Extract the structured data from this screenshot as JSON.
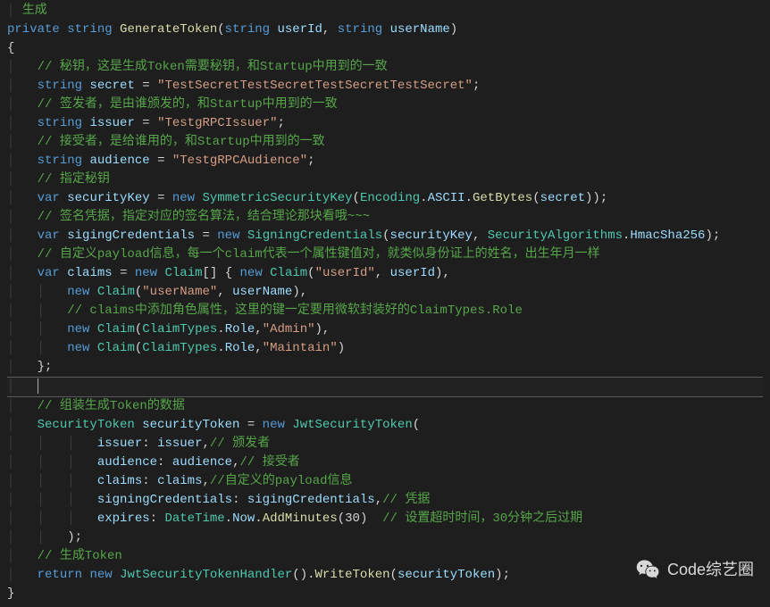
{
  "code": {
    "line0_partial": "生成",
    "sig_private": "private",
    "sig_string": "string",
    "sig_method": "GenerateToken",
    "sig_param1_type": "string",
    "sig_param1_name": "userId",
    "sig_param2_type": "string",
    "sig_param2_name": "userName",
    "comment1": "// 秘钥，这是生成Token需要秘钥，和Startup中用到的一致",
    "l3_type": "string",
    "l3_var": "secret",
    "l3_val": "\"TestSecretTestSecretTestSecretTestSecret\"",
    "comment2": "// 签发者，是由谁颁发的，和Startup中用到的一致",
    "l5_type": "string",
    "l5_var": "issuer",
    "l5_val": "\"TestgRPCIssuer\"",
    "comment3": "// 接受者，是给谁用的，和Startup中用到的一致",
    "l7_type": "string",
    "l7_var": "audience",
    "l7_val": "\"TestgRPCAudience\"",
    "comment4": "// 指定秘钥",
    "l9_var_kw": "var",
    "l9_var": "securityKey",
    "l9_new": "new",
    "l9_type": "SymmetricSecurityKey",
    "l9_enc": "Encoding",
    "l9_ascii": "ASCII",
    "l9_getbytes": "GetBytes",
    "l9_secret": "secret",
    "comment5": "// 签名凭据，指定对应的签名算法，结合理论那块看哦~~~",
    "l11_var_kw": "var",
    "l11_var": "sigingCredentials",
    "l11_new": "new",
    "l11_type": "SigningCredentials",
    "l11_arg1": "securityKey",
    "l11_secalg": "SecurityAlgorithms",
    "l11_hmac": "HmacSha256",
    "comment6": "// 自定义payload信息，每一个claim代表一个属性键值对，就类似身份证上的姓名，出生年月一样",
    "l13_var_kw": "var",
    "l13_var": "claims",
    "l13_new": "new",
    "l13_claim": "Claim",
    "l13_new2": "new",
    "l13_claim2": "Claim",
    "l13_key": "\"userId\"",
    "l13_val": "userId",
    "l14_new": "new",
    "l14_claim": "Claim",
    "l14_key": "\"userName\"",
    "l14_val": "userName",
    "comment7": "// claims中添加角色属性，这里的键一定要用微软封装好的ClaimTypes.Role",
    "l16_new": "new",
    "l16_claim": "Claim",
    "l16_ct": "ClaimTypes",
    "l16_role": "Role",
    "l16_val": "\"Admin\"",
    "l17_new": "new",
    "l17_claim": "Claim",
    "l17_ct": "ClaimTypes",
    "l17_role": "Role",
    "l17_val": "\"Maintain\"",
    "comment8": "// 组装生成Token的数据",
    "l20_type": "SecurityToken",
    "l20_var": "securityToken",
    "l20_new": "new",
    "l20_jwt": "JwtSecurityToken",
    "l21_key": "issuer",
    "l21_val": "issuer",
    "l21_comment": "// 颁发者",
    "l22_key": "audience",
    "l22_val": "audience",
    "l22_comment": "// 接受者",
    "l23_key": "claims",
    "l23_val": "claims",
    "l23_comment": "//自定义的payload信息",
    "l24_key": "signingCredentials",
    "l24_val": "sigingCredentials",
    "l24_comment": "// 凭据",
    "l25_key": "expires",
    "l25_dt": "DateTime",
    "l25_now": "Now",
    "l25_method": "AddMinutes",
    "l25_arg": "30",
    "l25_comment": "// 设置超时时间，30分钟之后过期",
    "comment9": "// 生成Token",
    "l27_return": "return",
    "l27_new": "new",
    "l27_handler": "JwtSecurityTokenHandler",
    "l27_write": "WriteToken",
    "l27_arg": "securityToken"
  },
  "watermark": {
    "text": "Code综艺圈"
  }
}
